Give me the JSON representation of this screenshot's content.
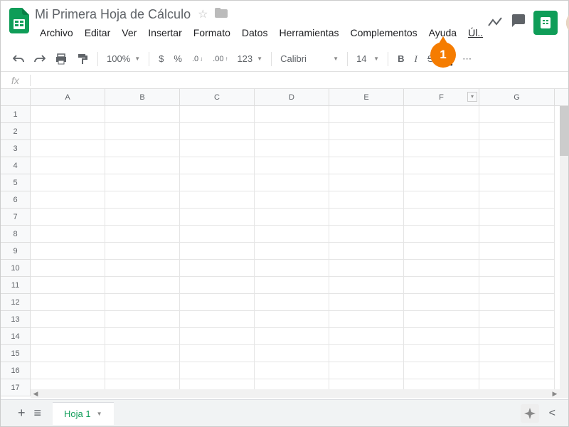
{
  "doc": {
    "title": "Mi Primera Hoja de Cálculo"
  },
  "menu": [
    "Archivo",
    "Editar",
    "Ver",
    "Insertar",
    "Formato",
    "Datos",
    "Herramientas",
    "Complementos",
    "Ayuda",
    "Úl.."
  ],
  "toolbar": {
    "zoom": "100%",
    "currency": "$",
    "percent": "%",
    "dec_dec": ".0",
    "dec_inc": ".00",
    "numfmt": "123",
    "font": "Calibri",
    "size": "14",
    "bold": "B",
    "italic": "I",
    "strike": "S",
    "color": "A"
  },
  "formula": {
    "fx": "fx"
  },
  "columns": [
    "A",
    "B",
    "C",
    "D",
    "E",
    "F",
    "G"
  ],
  "rows": [
    1,
    2,
    3,
    4,
    5,
    6,
    7,
    8,
    9,
    10,
    11,
    12,
    13,
    14,
    15,
    16,
    17
  ],
  "sheet": {
    "name": "Hoja 1"
  },
  "callout": {
    "num": "1"
  }
}
